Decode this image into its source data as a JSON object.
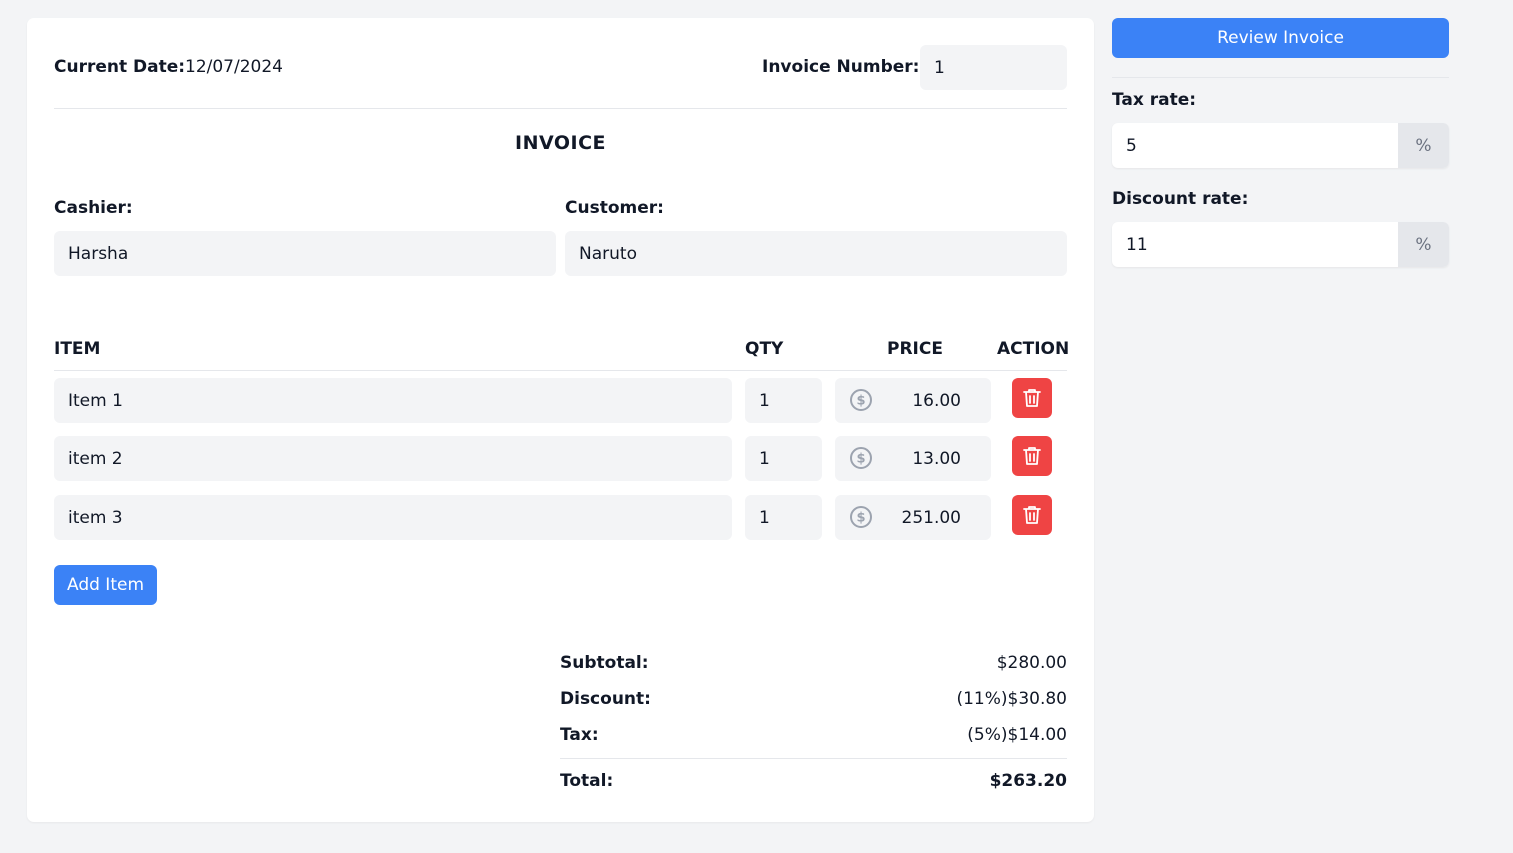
{
  "header": {
    "current_date_label": "Current Date:",
    "current_date_value": "12/07/2024",
    "invoice_number_label": "Invoice Number:",
    "invoice_number_value": "1"
  },
  "invoice_title": "INVOICE",
  "people": {
    "cashier_label": "Cashier:",
    "cashier_value": "Harsha",
    "customer_label": "Customer:",
    "customer_value": "Naruto"
  },
  "table": {
    "headers": {
      "item": "ITEM",
      "qty": "QTY",
      "price": "PRICE",
      "action": "ACTION"
    },
    "rows": [
      {
        "item": "Item 1",
        "qty": "1",
        "price": "16.00"
      },
      {
        "item": "item 2",
        "qty": "1",
        "price": "13.00"
      },
      {
        "item": "item 3",
        "qty": "1",
        "price": "251.00"
      }
    ],
    "price_icon": "dollar-circle-icon",
    "delete_icon": "trash-icon"
  },
  "add_item_label": "Add Item",
  "summary": {
    "subtotal_label": "Subtotal:",
    "subtotal_value": "$280.00",
    "discount_label": "Discount:",
    "discount_value": "(11%)$30.80",
    "tax_label": "Tax:",
    "tax_value": "(5%)$14.00",
    "total_label": "Total:",
    "total_value": "$263.20"
  },
  "sidebar": {
    "review_label": "Review Invoice",
    "tax_rate_label": "Tax rate:",
    "tax_rate_value": "5",
    "discount_rate_label": "Discount rate:",
    "discount_rate_value": "11",
    "percent_suffix": "%"
  },
  "colors": {
    "accent": "#3b82f6",
    "danger": "#ef4444",
    "field_bg": "#f3f4f6",
    "page_bg": "#f3f4f6"
  }
}
